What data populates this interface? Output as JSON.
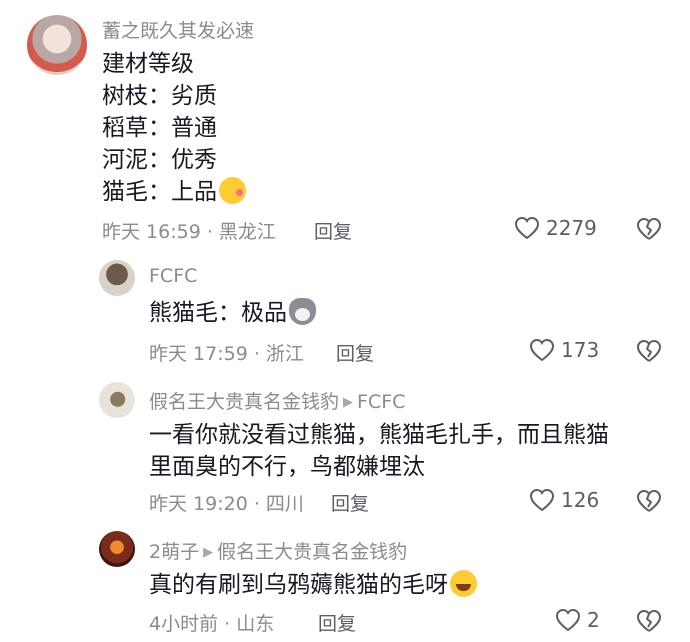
{
  "comments": [
    {
      "username": "蓄之既久其发必速",
      "lines": [
        "建材等级",
        "树枝：劣质",
        "稻草：普通",
        "河泥：优秀",
        "猫毛：上品"
      ],
      "emoji": "kissing-face-emoji",
      "time_location": "昨天 16:59 · 黑龙江",
      "reply_label": "回复",
      "likes": "2279"
    },
    {
      "username": "FCFC",
      "lines": [
        "熊猫毛：极品"
      ],
      "emoji": "husky-dog-emoji",
      "time_location": "昨天 17:59 · 浙江",
      "reply_label": "回复",
      "likes": "173"
    },
    {
      "username": "假名王大贵真名金钱豹",
      "reply_to": "FCFC",
      "lines": [
        "一看你就没看过熊猫，熊猫毛扎手，而且熊猫",
        "里面臭的不行，鸟都嫌埋汰"
      ],
      "time_location": "昨天 19:20 · 四川",
      "reply_label": "回复",
      "likes": "126"
    },
    {
      "username": "2萌子",
      "reply_to": "假名王大贵真名金钱豹",
      "lines": [
        "真的有刷到乌鸦薅熊猫的毛呀"
      ],
      "emoji": "laughing-crying-emoji",
      "time_location": "4小时前 · 山东",
      "reply_label": "回复",
      "likes": "2"
    }
  ]
}
